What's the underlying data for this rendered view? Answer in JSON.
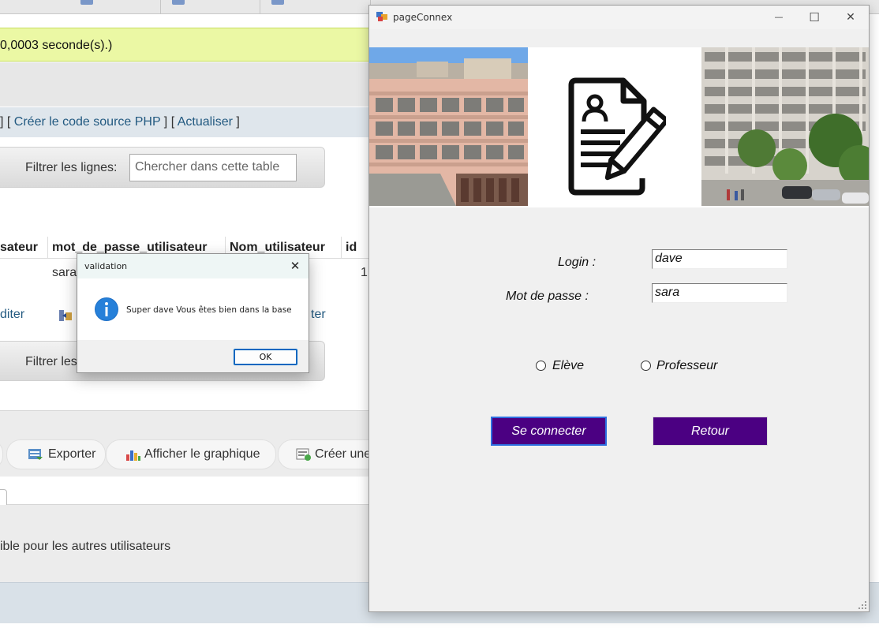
{
  "pma": {
    "success_text": "0,0003 seconde(s).)",
    "links": {
      "pre": "] [ ",
      "create_php": "Créer le code source PHP",
      "mid": " ] [ ",
      "refresh": "Actualiser",
      "post": " ]"
    },
    "filter_label": "Filtrer les lignes:",
    "filter_placeholder": "Chercher dans cette table",
    "filter_label_2": "Filtrer les",
    "columns": [
      "sateur",
      "mot_de_passe_utilisateur",
      "Nom_utilisateur",
      "id"
    ],
    "row": {
      "password": "sara",
      "id": "1"
    },
    "edit_link": "diter",
    "edit_link_right": "ter",
    "ops": {
      "export": "Exporter",
      "chart": "Afficher le graphique",
      "create": "Créer une"
    },
    "visible_text": "ible pour les autres utilisateurs"
  },
  "window": {
    "title": "pageConnex",
    "minimize": "—",
    "maximize": "☐",
    "close": "✕"
  },
  "form": {
    "login_label": "Login :",
    "login_value": "dave",
    "password_label": "Mot de passe :",
    "password_value": "sara",
    "radio_student": "Elève",
    "radio_teacher": "Professeur",
    "connect_button": "Se connecter",
    "back_button": "Retour"
  },
  "dialog": {
    "title": "validation",
    "close": "✕",
    "icon": "info-icon",
    "message": "Super dave Vous êtes bien dans la base",
    "ok": "OK"
  },
  "colors": {
    "button_purple": "#4b0082",
    "success_bg": "#ebf8a4",
    "link_blue": "#235a81"
  }
}
